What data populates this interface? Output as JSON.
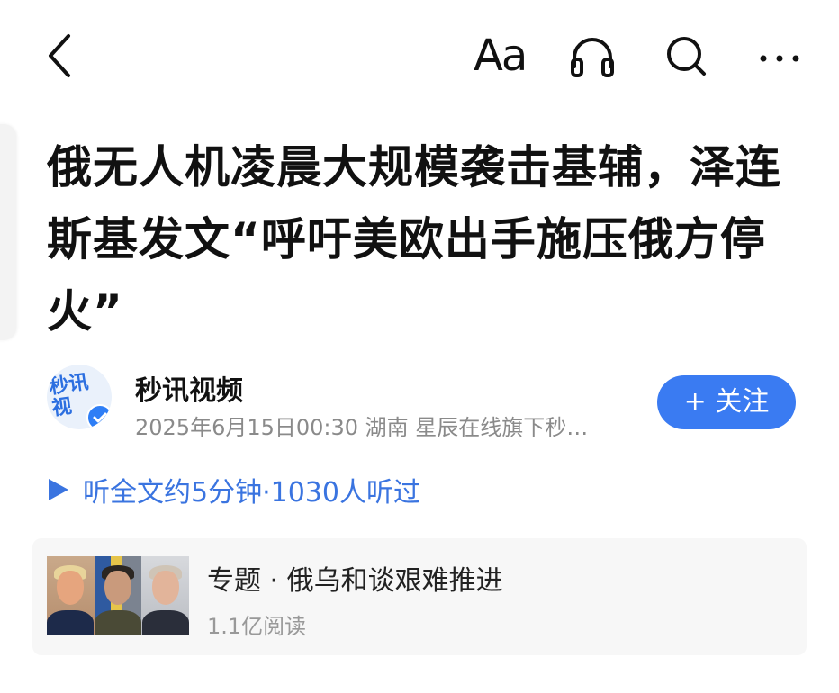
{
  "toolbar": {
    "font_label": "Aa"
  },
  "article": {
    "title": "俄无人机凌晨大规模袭击基辅，泽连斯基发文“呼吁美欧出手施压俄方停火”"
  },
  "author": {
    "avatar_text": "秒讯视",
    "name": "秒讯视频",
    "meta": "2025年6月15日00:30 湖南 星辰在线旗下秒…",
    "follow_label": "+ 关注"
  },
  "listen": {
    "label": "听全文约5分钟·1030人听过"
  },
  "topic": {
    "title": "专题 · 俄乌和谈艰难推进",
    "reads": "1.1亿阅读"
  },
  "colors": {
    "accent": "#3a7bf2",
    "link": "#3a74e0",
    "meta": "#8a8a8a",
    "card_bg": "#f7f7f7"
  },
  "icons": [
    "back-arrow-icon",
    "headphones-icon",
    "search-icon",
    "more-icon",
    "play-icon",
    "verified-icon"
  ]
}
